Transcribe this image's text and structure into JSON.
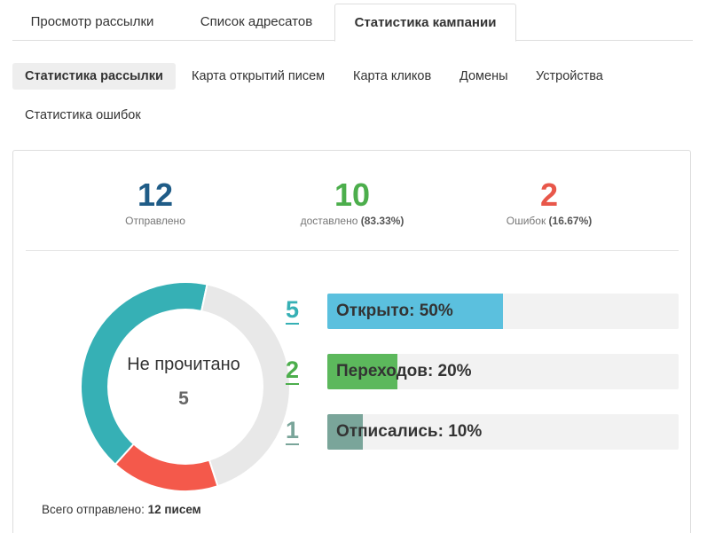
{
  "top_tabs": [
    {
      "label": "Просмотр рассылки"
    },
    {
      "label": "Список адресатов"
    },
    {
      "label": "Статистика кампании"
    }
  ],
  "sub_tabs": [
    {
      "label": "Статистика рассылки"
    },
    {
      "label": "Карта открытий писем"
    },
    {
      "label": "Карта кликов"
    },
    {
      "label": "Домены"
    },
    {
      "label": "Устройства"
    },
    {
      "label": "Статистика ошибок"
    }
  ],
  "stats": {
    "sent": {
      "value": "12",
      "label": "Отправлено",
      "color": "#1f5c87"
    },
    "delivered": {
      "value": "10",
      "label": "доставлено",
      "pct": "(83.33%)",
      "color": "#4cae4c"
    },
    "errors": {
      "value": "2",
      "label": "Ошибок",
      "pct": "(16.67%)",
      "color": "#e8574a"
    }
  },
  "donut": {
    "center_label": "Не прочитано",
    "center_value": "5",
    "segments": [
      {
        "name": "opened",
        "value": 5,
        "color": "#36b0b5"
      },
      {
        "name": "unread",
        "value": 5,
        "color": "#e8e8e8"
      },
      {
        "name": "error",
        "value": 2,
        "color": "#f4594b"
      }
    ]
  },
  "total": {
    "prefix": "Всего отправлено:",
    "value": "12 писем"
  },
  "bars": [
    {
      "count": "5",
      "label": "Открыто: 50%",
      "pct": 0.5,
      "fill": "#5bc0de",
      "num_color": "#36b0b5"
    },
    {
      "count": "2",
      "label": "Переходов: 20%",
      "pct": 0.2,
      "fill": "#5cb85c",
      "num_color": "#4cae4c"
    },
    {
      "count": "1",
      "label": "Отписались: 10%",
      "pct": 0.1,
      "fill": "#7aa59a",
      "num_color": "#7aa59a"
    }
  ]
}
